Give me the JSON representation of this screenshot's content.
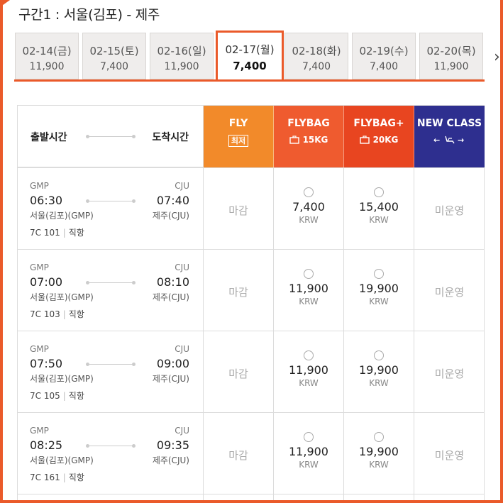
{
  "route": {
    "title": "구간1 :  서울(김포) - 제주"
  },
  "nav": {
    "prev_icon": "chevron-left-icon",
    "next_icon": "chevron-right-icon"
  },
  "dates": [
    {
      "label": "02-14(금)",
      "price": "11,900",
      "active": false
    },
    {
      "label": "02-15(토)",
      "price": "7,400",
      "active": false
    },
    {
      "label": "02-16(일)",
      "price": "11,900",
      "active": false
    },
    {
      "label": "02-17(월)",
      "price": "7,400",
      "active": true
    },
    {
      "label": "02-18(화)",
      "price": "7,400",
      "active": false
    },
    {
      "label": "02-19(수)",
      "price": "7,400",
      "active": false
    },
    {
      "label": "02-20(목)",
      "price": "11,900",
      "active": false
    }
  ],
  "header": {
    "departure_label": "출발시간",
    "arrival_label": "도착시간",
    "fares": [
      {
        "name": "FLY",
        "sub": "최저",
        "color": "#f28a2a"
      },
      {
        "name": "FLYBAG",
        "sub": "15KG",
        "icon": "baggage-icon",
        "color": "#ef5b2f"
      },
      {
        "name": "FLYBAG+",
        "sub": "20KG",
        "icon": "baggage-icon",
        "color": "#e84520"
      },
      {
        "name": "NEW CLASS",
        "sub": "← →",
        "icon": "seat-icon",
        "color": "#2e2f8f"
      }
    ]
  },
  "flights": [
    {
      "dep_code": "GMP",
      "dep_time": "06:30",
      "dep_city": "서울(김포)(GMP)",
      "arr_code": "CJU",
      "arr_time": "07:40",
      "arr_city": "제주(CJU)",
      "flight_no": "7C 101",
      "type": "직항",
      "fly": "마감",
      "flybag": "7,400",
      "flybag_plus": "15,400",
      "new_class": "미운영",
      "currency": "KRW"
    },
    {
      "dep_code": "GMP",
      "dep_time": "07:00",
      "dep_city": "서울(김포)(GMP)",
      "arr_code": "CJU",
      "arr_time": "08:10",
      "arr_city": "제주(CJU)",
      "flight_no": "7C 103",
      "type": "직항",
      "fly": "마감",
      "flybag": "11,900",
      "flybag_plus": "19,900",
      "new_class": "미운영",
      "currency": "KRW"
    },
    {
      "dep_code": "GMP",
      "dep_time": "07:50",
      "dep_city": "서울(김포)(GMP)",
      "arr_code": "CJU",
      "arr_time": "09:00",
      "arr_city": "제주(CJU)",
      "flight_no": "7C 105",
      "type": "직항",
      "fly": "마감",
      "flybag": "11,900",
      "flybag_plus": "19,900",
      "new_class": "미운영",
      "currency": "KRW"
    },
    {
      "dep_code": "GMP",
      "dep_time": "08:25",
      "dep_city": "서울(김포)(GMP)",
      "arr_code": "CJU",
      "arr_time": "09:35",
      "arr_city": "제주(CJU)",
      "flight_no": "7C 161",
      "type": "직항",
      "fly": "마감",
      "flybag": "11,900",
      "flybag_plus": "19,900",
      "new_class": "미운영",
      "currency": "KRW"
    }
  ],
  "colors": {
    "accent": "#ea5a2a",
    "new_class": "#2e2f8f"
  }
}
